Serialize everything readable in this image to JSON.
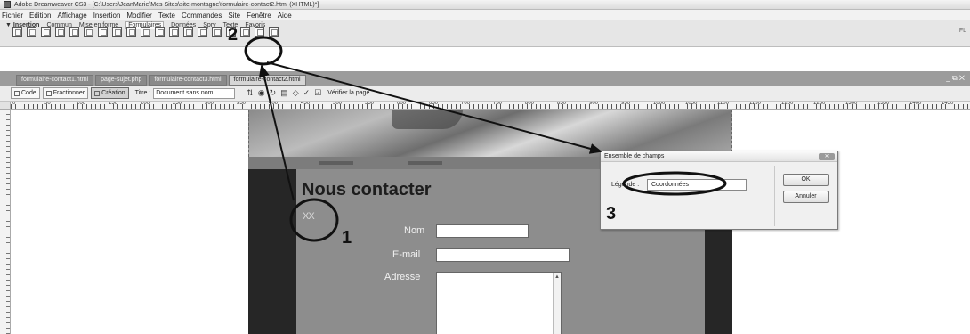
{
  "window": {
    "title": "Adobe Dreamweaver CS3 - [C:\\Users\\JeanMarie\\Mes Sites\\site-montagne\\formulaire-contact2.html (XHTML)*]"
  },
  "menu": [
    "Fichier",
    "Edition",
    "Affichage",
    "Insertion",
    "Modifier",
    "Texte",
    "Commandes",
    "Site",
    "Fenêtre",
    "Aide"
  ],
  "insert_bar": {
    "label": "▼ Insertion",
    "tabs": [
      "Commun",
      "Mise en forme",
      "Formulaires",
      "Données",
      "Spry",
      "Texte",
      "Favoris"
    ],
    "selected_tab": "Formulaires",
    "right_text": "FL"
  },
  "document_tabs": [
    "formulaire-contact1.html",
    "page-sujet.php",
    "formulaire-contact3.html",
    "formulaire-contact2.html"
  ],
  "doc_window_controls": "_ ⧉ ✕",
  "doc_toolbar": {
    "code": "Code",
    "split": "Fractionner",
    "design": "Création",
    "title_label": "Titre :",
    "title_value": "Document sans nom",
    "check_page": "Vérifier la page"
  },
  "ruler_numbers": [
    "0",
    "50",
    "100",
    "150",
    "200",
    "250",
    "300",
    "350",
    "400",
    "450",
    "500",
    "550",
    "600",
    "650",
    "700",
    "750",
    "800",
    "850",
    "900",
    "950",
    "1000",
    "1050",
    "1100",
    "1150",
    "1200",
    "1250",
    "1300",
    "1350",
    "1400",
    "1450"
  ],
  "page": {
    "heading": "Nous contacter",
    "placeholder": "XX",
    "fields": {
      "name_label": "Nom",
      "email_label": "E-mail",
      "address_label": "Adresse"
    }
  },
  "dialog": {
    "title": "Ensemble de champs",
    "legend_label": "Légende :",
    "legend_value": "Coordonnées",
    "ok": "OK",
    "cancel": "Annuler"
  },
  "annotations": [
    "1",
    "2",
    "3"
  ]
}
